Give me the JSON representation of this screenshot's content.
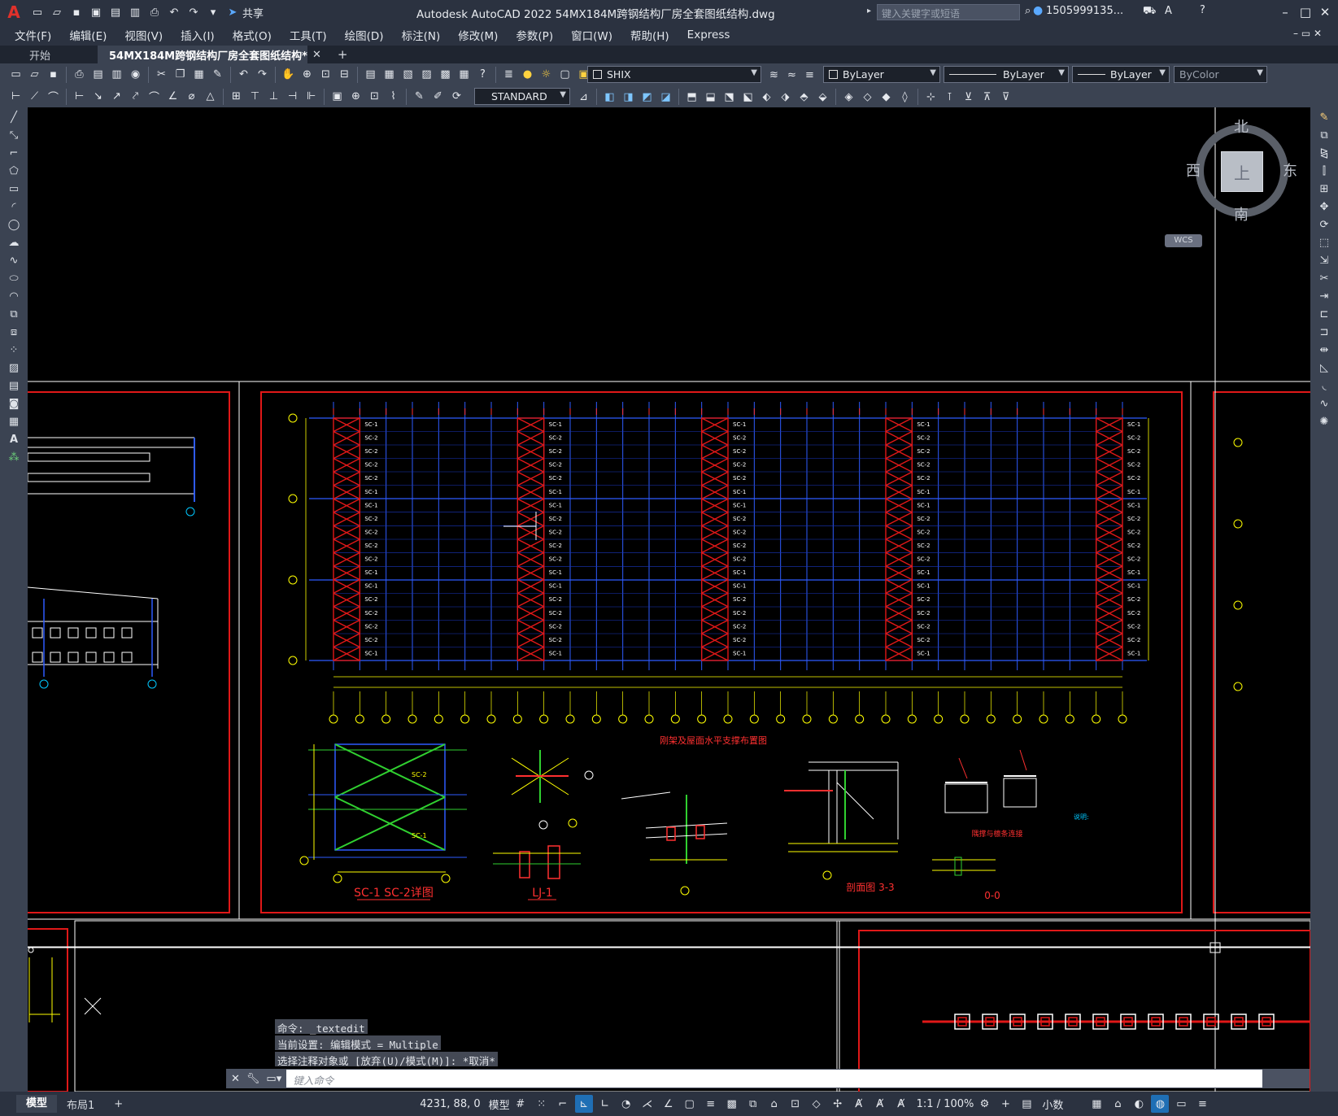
{
  "app": {
    "title": "Autodesk AutoCAD 2022    54MX184M跨钢结构厂房全套图纸结构.dwg",
    "share": "共享",
    "search_placeholder": "键入关键字或短语",
    "user": "1505999135...",
    "logo": "A"
  },
  "menu": [
    "文件(F)",
    "编辑(E)",
    "视图(V)",
    "插入(I)",
    "格式(O)",
    "工具(T)",
    "绘图(D)",
    "标注(N)",
    "修改(M)",
    "参数(P)",
    "窗口(W)",
    "帮助(H)",
    "Express"
  ],
  "tabs": {
    "start": "开始",
    "active": "54MX184M跨钢结构厂房全套图纸结构*",
    "add": "+"
  },
  "toolbar": {
    "font_style": "SHIX",
    "layer": "ByLayer",
    "linetype": "ByLayer",
    "lineweight": "ByLayer",
    "color": "ByColor",
    "text_style": "STANDARD"
  },
  "viewcube": {
    "north": "北",
    "south": "南",
    "west": "西",
    "east": "东",
    "face": "上",
    "wcs": "WCS"
  },
  "drawing": {
    "plan_title": "刚架及屋面水平支撑布置图",
    "detail_sc": "SC-1 SC-2详图",
    "detail_lj": "LJ-1",
    "detail_33": "剖面图 3-3",
    "detail_00": "0-0",
    "brace_1": "SC-1",
    "brace_2": "SC-2",
    "node_label": "隅撑与檩条连接",
    "notes_title": "说明:"
  },
  "command": {
    "history": [
      "命令: _textedit",
      "当前设置: 编辑模式 = Multiple",
      "选择注释对象或 [放弃(U)/模式(M)]: *取消*"
    ],
    "placeholder": "键入命令"
  },
  "status": {
    "model_tab": "模型",
    "layout_tab": "布局1",
    "coords": "4231, 88, 0",
    "model_space": "模型",
    "scale": "1:1 / 100%",
    "units": "小数"
  }
}
